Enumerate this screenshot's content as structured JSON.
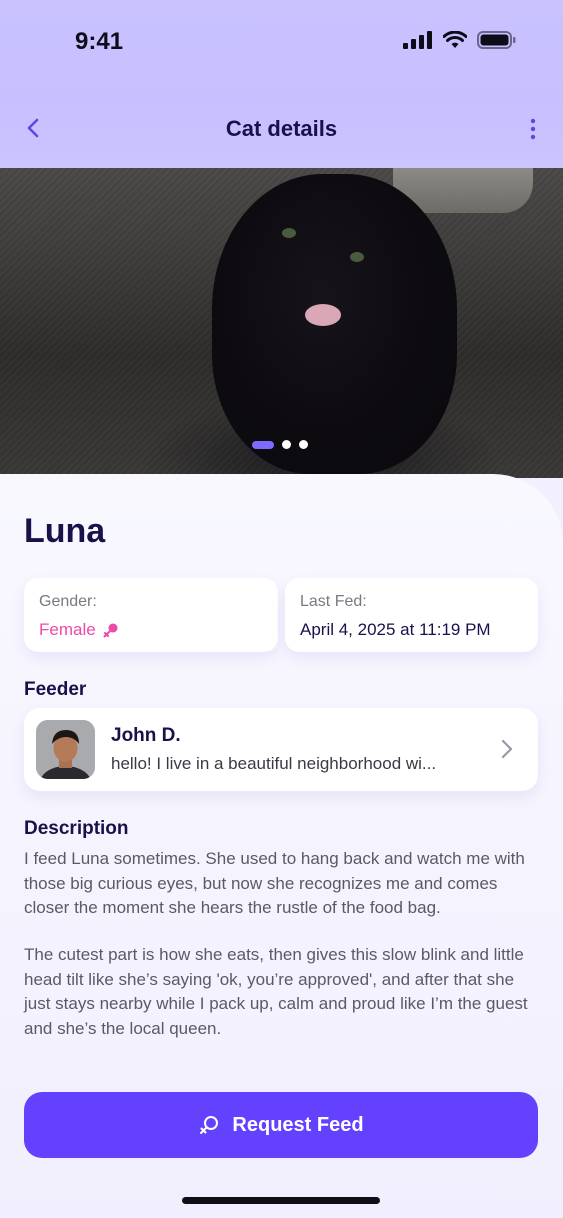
{
  "status_bar": {
    "time": "9:41"
  },
  "nav": {
    "title": "Cat details"
  },
  "hero": {
    "image_count": 3,
    "active_index": 0
  },
  "cat": {
    "name": "Luna"
  },
  "gender": {
    "label": "Gender:",
    "value": "Female"
  },
  "last_fed": {
    "label": "Last Fed:",
    "value": "April 4, 2025 at 11:19 PM"
  },
  "feeder_section": {
    "title": "Feeder",
    "name": "John D.",
    "bio": "hello! I live in a beautiful neighborhood wi..."
  },
  "description": {
    "title": "Description",
    "paragraphs": [
      "I feed Luna sometimes. She used to hang back and watch me with those big curious eyes, but now she recognizes me and comes closer the moment she hears the rustle of the food bag.",
      "The cutest part is how she eats, then gives this slow blink and little head tilt like she’s saying 'ok, you’re approved', and after that she just stays nearby while I pack up, calm and proud like I’m the guest and she’s the local queen."
    ]
  },
  "actions": {
    "request_feed": "Request Feed"
  },
  "colors": {
    "accent": "#6341ff",
    "female": "#ec4aa9",
    "header": "#c9c2ff",
    "text": "#17124a"
  }
}
